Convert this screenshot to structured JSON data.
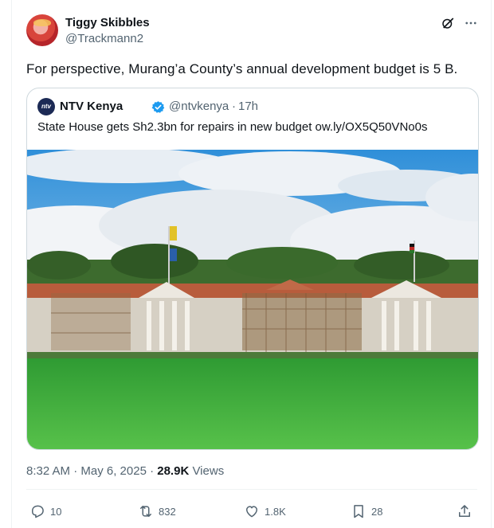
{
  "author": {
    "display_name": "Tiggy Skibbles",
    "handle": "@Trackmann2",
    "avatar_icon": "profile-avatar"
  },
  "tweet": {
    "text": "For perspective, Murang’a County’s annual development budget is 5 B."
  },
  "quoted": {
    "avatar_text": "ntv",
    "display_name": "NTV Kenya",
    "verified_icon": "verified-badge-icon",
    "handle": "@ntvkenya",
    "separator": "·",
    "time": "17h",
    "text": "State House gets Sh2.3bn for repairs in new budget ow.ly/OX5Q50VNo0s"
  },
  "meta": {
    "time_date": "8:32 AM · May 6, 2025 · ",
    "views_count": "28.9K",
    "views_label": " Views"
  },
  "actions": {
    "reply_count": "10",
    "repost_count": "832",
    "like_count": "1.8K",
    "bookmark_count": "28"
  },
  "colors": {
    "accent": "#1d9bf0",
    "text_primary": "#0f1419",
    "text_secondary": "#536471",
    "border": "#cfd9de"
  }
}
